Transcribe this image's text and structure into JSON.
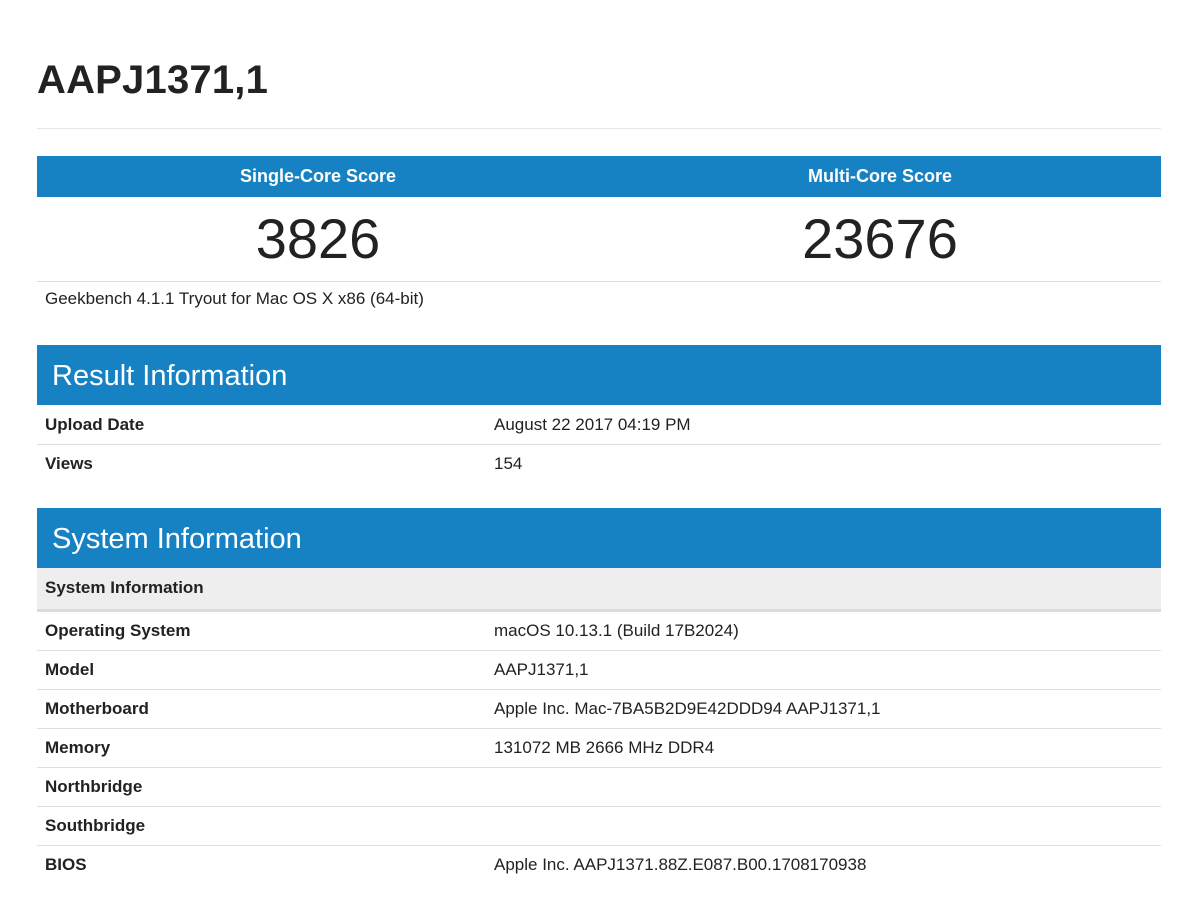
{
  "device_title": "AAPJ1371,1",
  "scores": {
    "single_label": "Single-Core Score",
    "single_value": "3826",
    "multi_label": "Multi-Core Score",
    "multi_value": "23676"
  },
  "version_text": "Geekbench 4.1.1 Tryout for Mac OS X x86 (64-bit)",
  "result_info": {
    "heading": "Result Information",
    "rows": [
      {
        "key": "Upload Date",
        "value": "August 22 2017 04:19 PM"
      },
      {
        "key": "Views",
        "value": "154"
      }
    ]
  },
  "system_info": {
    "heading": "System Information",
    "subheading": "System Information",
    "rows": [
      {
        "key": "Operating System",
        "value": "macOS 10.13.1 (Build 17B2024)"
      },
      {
        "key": "Model",
        "value": "AAPJ1371,1"
      },
      {
        "key": "Motherboard",
        "value": "Apple Inc. Mac-7BA5B2D9E42DDD94 AAPJ1371,1"
      },
      {
        "key": "Memory",
        "value": "131072 MB 2666 MHz DDR4"
      },
      {
        "key": "Northbridge",
        "value": ""
      },
      {
        "key": "Southbridge",
        "value": ""
      },
      {
        "key": "BIOS",
        "value": "Apple Inc. AAPJ1371.88Z.E087.B00.1708170938"
      }
    ]
  },
  "colors": {
    "header_blue": "#1782c3",
    "subheader_gray": "#eeeeee",
    "text": "#222222"
  }
}
